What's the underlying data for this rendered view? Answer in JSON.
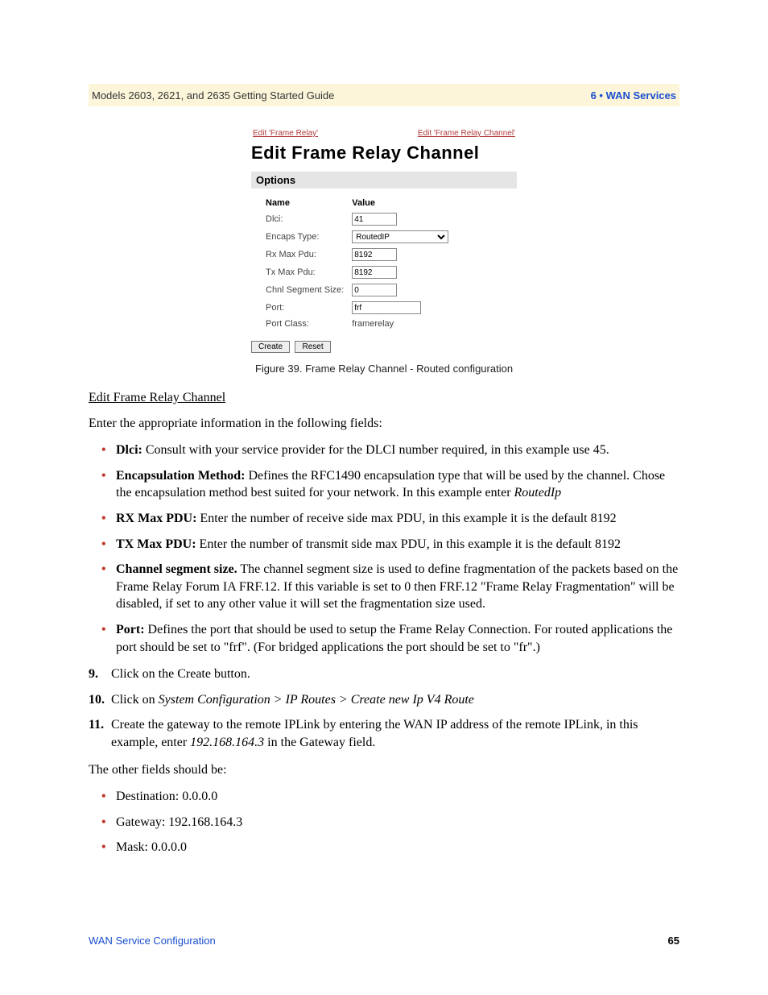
{
  "header": {
    "left": "Models 2603, 2621, and 2635 Getting Started Guide",
    "right": "6 • WAN Services"
  },
  "figure": {
    "crumb_left": "Edit 'Frame Relay'",
    "crumb_right": "Edit 'Frame Relay Channel'",
    "title": "Edit Frame Relay Channel",
    "options_label": "Options",
    "col_name": "Name",
    "col_value": "Value",
    "rows": {
      "dlci_label": "Dlci:",
      "dlci_value": "41",
      "encaps_label": "Encaps Type:",
      "encaps_value": "RoutedIP",
      "rx_label": "Rx Max Pdu:",
      "rx_value": "8192",
      "tx_label": "Tx Max Pdu:",
      "tx_value": "8192",
      "seg_label": "Chnl Segment Size:",
      "seg_value": "0",
      "port_label": "Port:",
      "port_value": "frf",
      "class_label": "Port Class:",
      "class_value": "framerelay"
    },
    "btn_create": "Create",
    "btn_reset": "Reset",
    "caption": "Figure 39. Frame Relay Channel - Routed configuration"
  },
  "section": {
    "heading": "Edit Frame Relay Channel",
    "intro": "Enter the appropriate information in the following fields:",
    "bullets": {
      "b1_label": "Dlci:",
      "b1_text": " Consult with your service provider for the DLCI number required, in this example use 45.",
      "b2_label": "Encapsulation Method:",
      "b2_text_a": " Defines the RFC1490 encapsulation type that will be used by the channel. Chose the encapsulation method best suited for your network. In this example enter ",
      "b2_text_i": "RoutedIp",
      "b3_label": "RX Max PDU:",
      "b3_text": " Enter the number of receive side max PDU, in this example it is the default 8192",
      "b4_label": "TX Max PDU:",
      "b4_text": " Enter the number of transmit side max PDU, in this example it is the default 8192",
      "b5_label": "Channel segment size.",
      "b5_text": " The channel segment size is used to define fragmentation of the packets based on the Frame Relay Forum IA FRF.12. If this variable is set to 0 then FRF.12 \"Frame Relay Fragmentation\" will be disabled, if set to any other value it will set the fragmentation size used.",
      "b6_label": "Port:",
      "b6_text": " Defines the port that should be used to setup the Frame Relay Connection. For routed applications the port should be set to \"frf\". (For bridged applications the port should be set to \"fr\".)"
    },
    "steps": {
      "s9_num": "9.",
      "s9_text": "Click on the Create button.",
      "s10_num": "10.",
      "s10_a": "Click on ",
      "s10_i": "System Configuration > IP Routes > Create new Ip V4 Route",
      "s11_num": "11.",
      "s11_a": "Create the gateway to the remote IPLink by entering the WAN IP address of the remote IPLink, in this example, enter ",
      "s11_i": "192.168.164.3",
      "s11_b": " in the Gateway field."
    },
    "other_intro": "The other fields should be:",
    "other": {
      "o1": "Destination: 0.0.0.0",
      "o2": "Gateway: 192.168.164.3",
      "o3": "Mask: 0.0.0.0"
    }
  },
  "footer": {
    "left": "WAN Service Configuration",
    "right": "65"
  }
}
